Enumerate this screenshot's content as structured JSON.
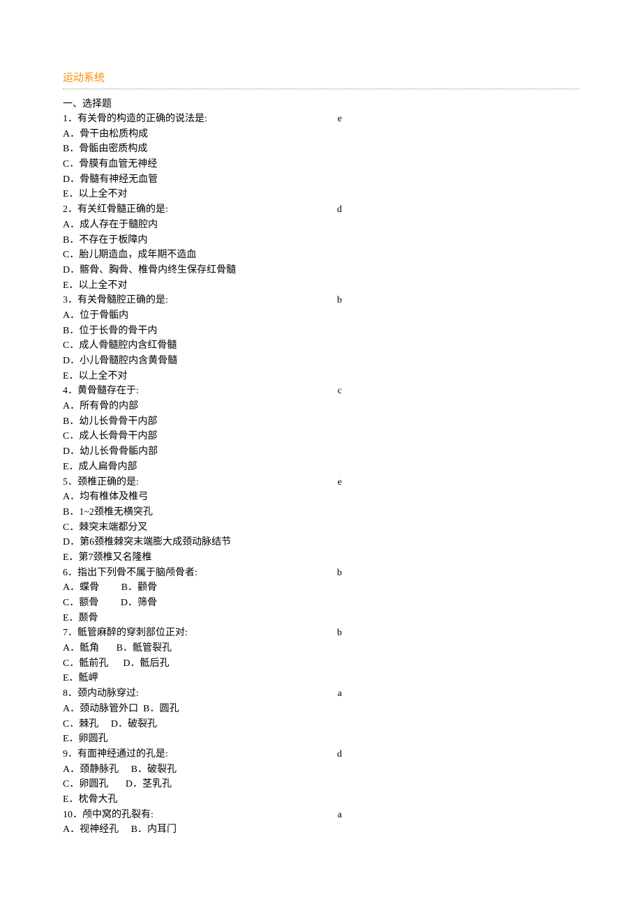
{
  "title": "运动系统",
  "sectionHeader": "一、选择题",
  "questions": [
    {
      "num": "1．",
      "text": "有关骨的构造的正确的说法是:",
      "answer": "e",
      "options": [
        "A．骨干由松质构成",
        "B．骨骺由密质构成",
        "C．骨膜有血管无神经",
        "D．骨髓有神经无血管",
        "E．以上全不对"
      ]
    },
    {
      "num": "2．",
      "text": "有关红骨髓正确的是:",
      "answer": "d",
      "options": [
        "A．成人存在于髓腔内",
        "B．不存在于板障内",
        "C．胎儿期造血，成年期不造血",
        "D．髂骨、胸骨、椎骨内终生保存红骨髓",
        "E．以上全不对"
      ]
    },
    {
      "num": "3．",
      "text": "有关骨髓腔正确的是:",
      "answer": "b",
      "options": [
        "A．位于骨骺内",
        "B．位于长骨的骨干内",
        "C．成人骨髓腔内含红骨髓",
        "D．小儿骨髓腔内含黄骨髓",
        "E．以上全不对"
      ]
    },
    {
      "num": "4．",
      "text": "黄骨髓存在于:",
      "answer": "c",
      "options": [
        "A．所有骨的内部",
        "B．幼儿长骨骨干内部",
        "C．成人长骨骨干内部",
        "D．幼儿长骨骨骺内部",
        "E．成人扁骨内部"
      ]
    },
    {
      "num": "5．",
      "text": "颈椎正确的是:",
      "answer": "e",
      "options": [
        "A．均有椎体及椎弓",
        "B．1~2颈椎无横突孔",
        "C．棘突末端都分叉",
        "D．第6颈椎棘突末端膨大成颈动脉结节",
        "E．第7颈椎又名隆椎"
      ]
    },
    {
      "num": "6．",
      "text": "指出下列骨不属于脑颅骨者:",
      "answer": "b",
      "options": [
        "A．蝶骨         B．颧骨",
        "C．额骨         D．筛骨",
        "E．颞骨"
      ]
    },
    {
      "num": "7．",
      "text": "骶管麻醉的穿刺部位正对:",
      "answer": "b",
      "options": [
        "A．骶角       B．骶管裂孔",
        "C．骶前孔      D．骶后孔",
        "E．骶岬"
      ]
    },
    {
      "num": "8．",
      "text": "颈内动脉穿过:",
      "answer": "a",
      "options": [
        "A．颈动脉管外口  B．圆孔",
        "C．棘孔     D．破裂孔",
        "E．卵圆孔"
      ]
    },
    {
      "num": "9．",
      "text": "有面神经通过的孔是:",
      "answer": "d",
      "options": [
        "A．颈静脉孔     B．破裂孔",
        "C．卵圆孔       D．茎乳孔",
        "E．枕骨大孔"
      ]
    },
    {
      "num": "10．",
      "text": "颅中窝的孔裂有:",
      "answer": "a",
      "options": [
        "A．视神经孔     B．内耳门"
      ]
    }
  ]
}
